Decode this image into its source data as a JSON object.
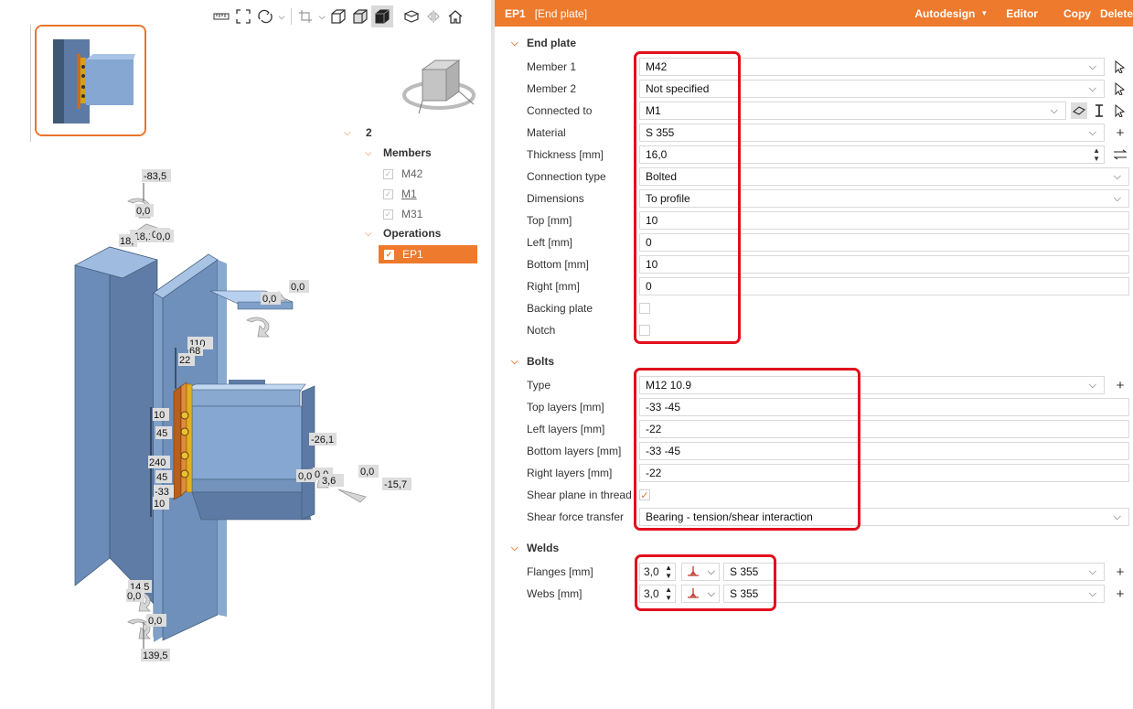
{
  "toolbar": {
    "icons": [
      "measure-icon",
      "fit-icon",
      "rotate-icon",
      "crop-icon",
      "wireframe-cube-icon",
      "transparent-cube-icon",
      "solid-cube-icon",
      "section-icon",
      "mirror-icon",
      "home-icon"
    ]
  },
  "tree": {
    "root": "2",
    "members_label": "Members",
    "members": [
      "M42",
      "M1",
      "M31"
    ],
    "operations_label": "Operations",
    "operations": [
      "EP1"
    ]
  },
  "model_labels": {
    "top_moment": "-83,5",
    "m1": "0,0",
    "m2": "-18,1",
    "m3": "0,0",
    "m4": "0,0",
    "m5": "18,",
    "beam_top1": "0,0",
    "beam_top2": "0,0",
    "dim_110": "110",
    "dim_68": "68",
    "dim_22": "22",
    "dim_10a": "10",
    "dim_45a": "45",
    "dim_240": "240",
    "dim_45b": "45",
    "dim_33": "-33",
    "dim_10b": "10",
    "f1": "-26,1",
    "f2": "0,0",
    "f3": "0,0",
    "f4": "3,6",
    "f5": "0,0",
    "f6": "-15,7",
    "b1": "14,5",
    "b2": "0,0",
    "b3": "0,0",
    "bottom_moment": "139,5"
  },
  "header": {
    "code": "EP1",
    "title": "[End plate]",
    "autodesign": "Autodesign",
    "editor": "Editor",
    "copy": "Copy",
    "delete": "Delete"
  },
  "end_plate": {
    "section": "End plate",
    "rows": [
      {
        "label": "Member 1",
        "value": "M42"
      },
      {
        "label": "Member 2",
        "value": "Not specified"
      },
      {
        "label": "Connected to",
        "value": "M1"
      },
      {
        "label": "Material",
        "value": "S 355"
      },
      {
        "label": "Thickness [mm]",
        "value": "16,0"
      },
      {
        "label": "Connection type",
        "value": "Bolted"
      },
      {
        "label": "Dimensions",
        "value": "To profile"
      },
      {
        "label": "Top [mm]",
        "value": "10"
      },
      {
        "label": "Left [mm]",
        "value": "0"
      },
      {
        "label": "Bottom [mm]",
        "value": "10"
      },
      {
        "label": "Right [mm]",
        "value": "0"
      },
      {
        "label": "Backing plate",
        "value": ""
      },
      {
        "label": "Notch",
        "value": ""
      }
    ]
  },
  "bolts": {
    "section": "Bolts",
    "rows": [
      {
        "label": "Type",
        "value": "M12 10.9"
      },
      {
        "label": "Top layers [mm]",
        "value": "-33 -45"
      },
      {
        "label": "Left layers [mm]",
        "value": "-22"
      },
      {
        "label": "Bottom layers [mm]",
        "value": "-33 -45"
      },
      {
        "label": "Right layers [mm]",
        "value": "-22"
      },
      {
        "label": "Shear plane in thread",
        "value": "✓"
      },
      {
        "label": "Shear force transfer",
        "value": "Bearing - tension/shear interaction"
      }
    ]
  },
  "welds": {
    "section": "Welds",
    "rows": [
      {
        "label": "Flanges [mm]",
        "thickness": "3,0",
        "material": "S 355"
      },
      {
        "label": "Webs [mm]",
        "thickness": "3,0",
        "material": "S 355"
      }
    ]
  },
  "colors": {
    "accent": "#ee7a2d",
    "highlight": "#e20f1d",
    "steel": "#7fa0c8"
  }
}
